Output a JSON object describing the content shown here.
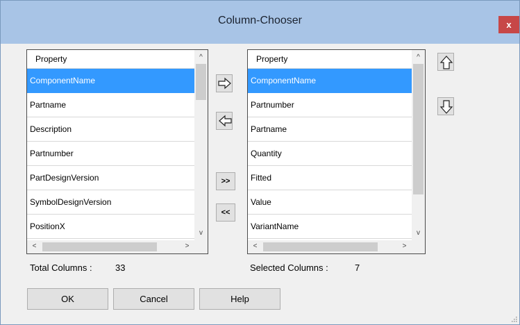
{
  "window": {
    "title": "Column-Chooser",
    "close": "x"
  },
  "available": {
    "header": "Property",
    "rows": [
      "ComponentName",
      "Partname",
      "Description",
      "Partnumber",
      "PartDesignVersion",
      "SymbolDesignVersion",
      "PositionX"
    ],
    "selected_index": 0
  },
  "selected": {
    "header": "Property",
    "rows": [
      "ComponentName",
      "Partnumber",
      "Partname",
      "Quantity",
      "Fitted",
      "Value",
      "VariantName"
    ],
    "selected_index": 0
  },
  "transfer": {
    "add_all": ">>",
    "remove_all": "<<"
  },
  "scroll": {
    "up": "^",
    "down": "v",
    "left": "<",
    "right": ">"
  },
  "footer": {
    "total_label": "Total Columns :",
    "total_value": "33",
    "selected_label": "Selected Columns :",
    "selected_value": "7"
  },
  "buttons": {
    "ok": "OK",
    "cancel": "Cancel",
    "help": "Help"
  },
  "colors": {
    "titlebar": "#a8c4e6",
    "selection": "#3399ff",
    "close": "#c74747"
  },
  "icons": [
    "arrow-right-icon",
    "arrow-left-icon",
    "arrow-up-icon",
    "arrow-down-icon",
    "close-icon",
    "resize-grip-icon"
  ]
}
